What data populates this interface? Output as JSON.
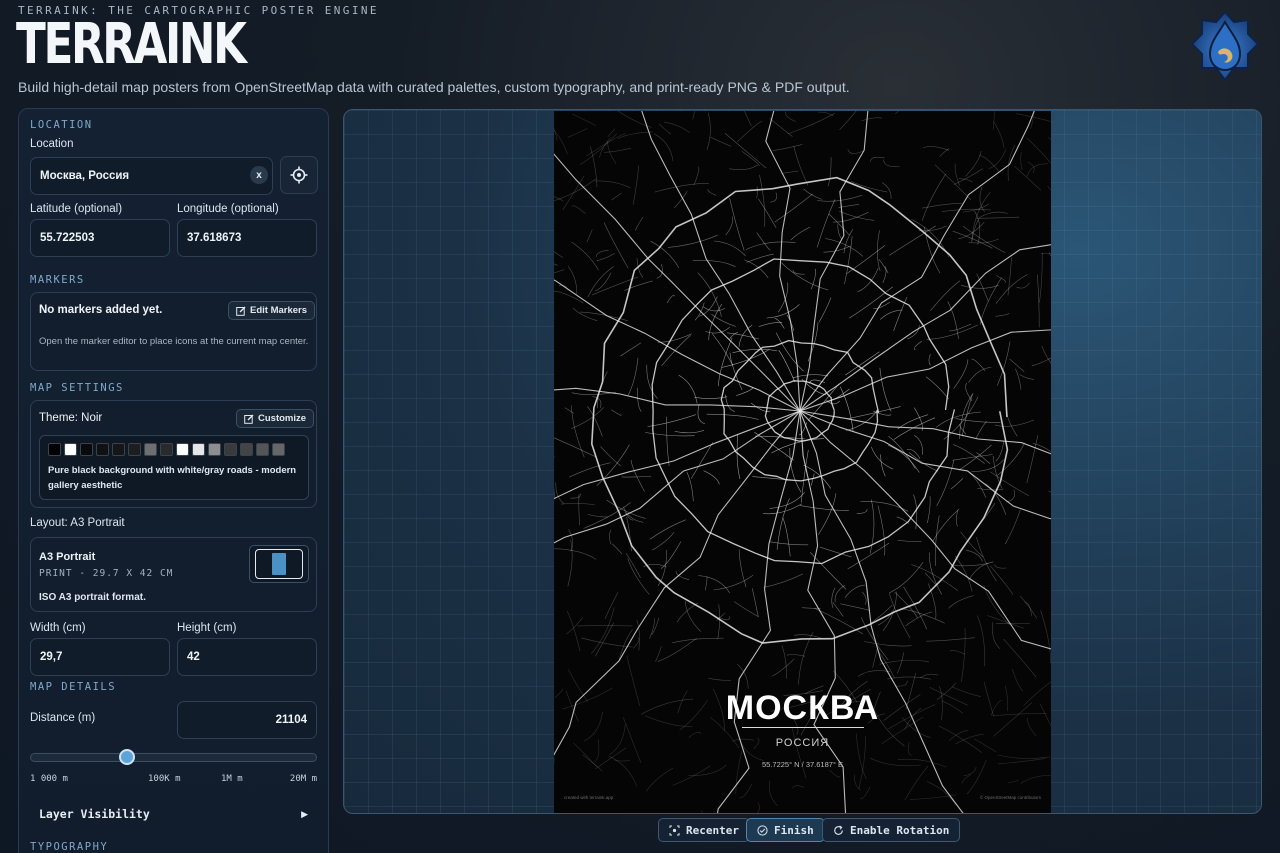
{
  "header": {
    "kicker": "TERRAINK: THE CARTOGRAPHIC POSTER ENGINE",
    "brand": "TERRAINK",
    "tagline": "Build high-detail map posters from OpenStreetMap data with curated palettes, custom typography, and print-ready PNG & PDF output."
  },
  "location": {
    "section": "LOCATION",
    "label": "Location",
    "value": "Москва, Россия",
    "clear_label": "x",
    "lat_label": "Latitude (optional)",
    "lat_value": "55.722503",
    "lon_label": "Longitude (optional)",
    "lon_value": "37.618673"
  },
  "markers": {
    "section": "MARKERS",
    "empty_text": "No markers added yet.",
    "edit_button": "Edit Markers",
    "hint": "Open the marker editor to place icons at the current map center."
  },
  "map_settings": {
    "section": "MAP SETTINGS",
    "theme_label": "Theme: Noir",
    "customize_button": "Customize",
    "palette": [
      "#000000",
      "#ffffff",
      "#0a0a0a",
      "#111111",
      "#161616",
      "#1e1e1e",
      "#6e6e6e",
      "#2a2a2a",
      "#ffffff",
      "#e6e6e6",
      "#8e8e8e",
      "#3a3a3a",
      "#444444",
      "#555555",
      "#666666"
    ],
    "theme_desc": "Pure black background with white/gray roads - modern gallery aesthetic",
    "layout_label": "Layout: A3 Portrait",
    "layout_name": "A3 Portrait",
    "layout_meta": "PRINT - 29.7 X 42 CM",
    "layout_desc": "ISO A3 portrait format.",
    "width_label": "Width (cm)",
    "width_value": "29,7",
    "height_label": "Height (cm)",
    "height_value": "42"
  },
  "map_details": {
    "section": "MAP DETAILS",
    "distance_label": "Distance (m)",
    "distance_value": "21104",
    "slider_fraction": 0.33,
    "ticks": [
      "1 000 m",
      "100K m",
      "1M m",
      "20M m"
    ],
    "layer_visibility": "Layer Visibility",
    "typography_section": "TYPOGRAPHY"
  },
  "poster": {
    "city": "МОСКВА",
    "country": "РОССИЯ",
    "coords": "55.7225° N / 37.6187° E",
    "footer_left": "created with terraink.app",
    "footer_right": "© OpenStreetMap contributors"
  },
  "controls": {
    "recenter": "Recenter",
    "finish": "Finish",
    "rotation": "Enable Rotation"
  }
}
